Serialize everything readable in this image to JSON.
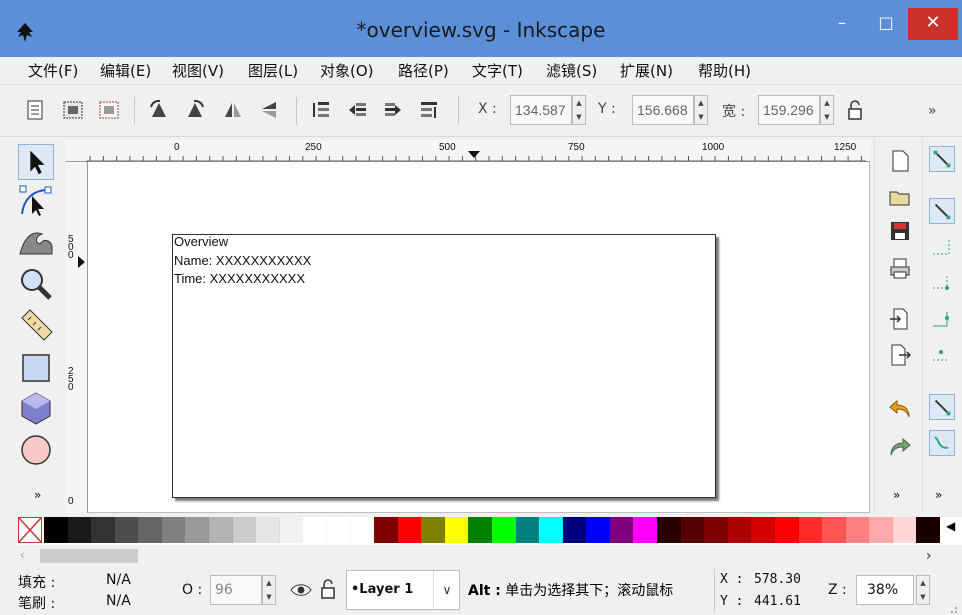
{
  "window": {
    "title": "*overview.svg - Inkscape",
    "min_glyph": "–",
    "max_glyph": "□",
    "close_glyph": "✕"
  },
  "menu": {
    "items": [
      "文件(F)",
      "编辑(E)",
      "视图(V)",
      "图层(L)",
      "对象(O)",
      "路径(P)",
      "文字(T)",
      "滤镜(S)",
      "扩展(N)",
      "帮助(H)"
    ]
  },
  "toolbar": {
    "x_label": "X :",
    "x_value": "134.587",
    "y_label": "Y :",
    "y_value": "156.668",
    "w_label": "宽 :",
    "w_value": "159.296",
    "overflow": "»"
  },
  "rulers": {
    "h_labels": [
      "0",
      "250",
      "500",
      "750",
      "1000",
      "1250"
    ],
    "v_labels": [
      "5\n0\n0",
      "2\n5\n0",
      "0"
    ]
  },
  "document": {
    "line1": "Overview",
    "line2": "Name: XXXXXXXXXXX",
    "line3": "Time:   XXXXXXXXXXX"
  },
  "left_tools": {
    "overflow": "»"
  },
  "right_panels": {
    "overflow": "»"
  },
  "palette": {
    "colors": [
      "#000000",
      "#1a1a1a",
      "#333333",
      "#4d4d4d",
      "#666666",
      "#808080",
      "#999999",
      "#b3b3b3",
      "#cccccc",
      "#e6e6e6",
      "#f2f2f2",
      "#ffffff",
      "#ffffff",
      "#ffffff",
      "#800000",
      "#ff0000",
      "#808000",
      "#ffff00",
      "#008000",
      "#00ff00",
      "#008080",
      "#00ffff",
      "#000080",
      "#0000ff",
      "#800080",
      "#ff00ff",
      "#2b0000",
      "#550000",
      "#800000",
      "#aa0000",
      "#d40000",
      "#ff0000",
      "#ff2a2a",
      "#ff5555",
      "#ff8080",
      "#ffaaaa",
      "#ffd5d5",
      "#1a0000"
    ]
  },
  "status": {
    "fill_label": "填充 :",
    "fill_value": "N/A",
    "stroke_label": "笔刷 :",
    "stroke_value": "N/A",
    "opacity_label": "O :",
    "opacity_value": "96",
    "layer_name": "•Layer 1",
    "message_bold": "Alt :",
    "message_rest": "单击为选择其下；滚动鼠标",
    "cursor_x_label": "X :",
    "cursor_x": "578.30",
    "cursor_y_label": "Y :",
    "cursor_y": "441.61",
    "zoom_label": "Z :",
    "zoom_value": "38%"
  }
}
